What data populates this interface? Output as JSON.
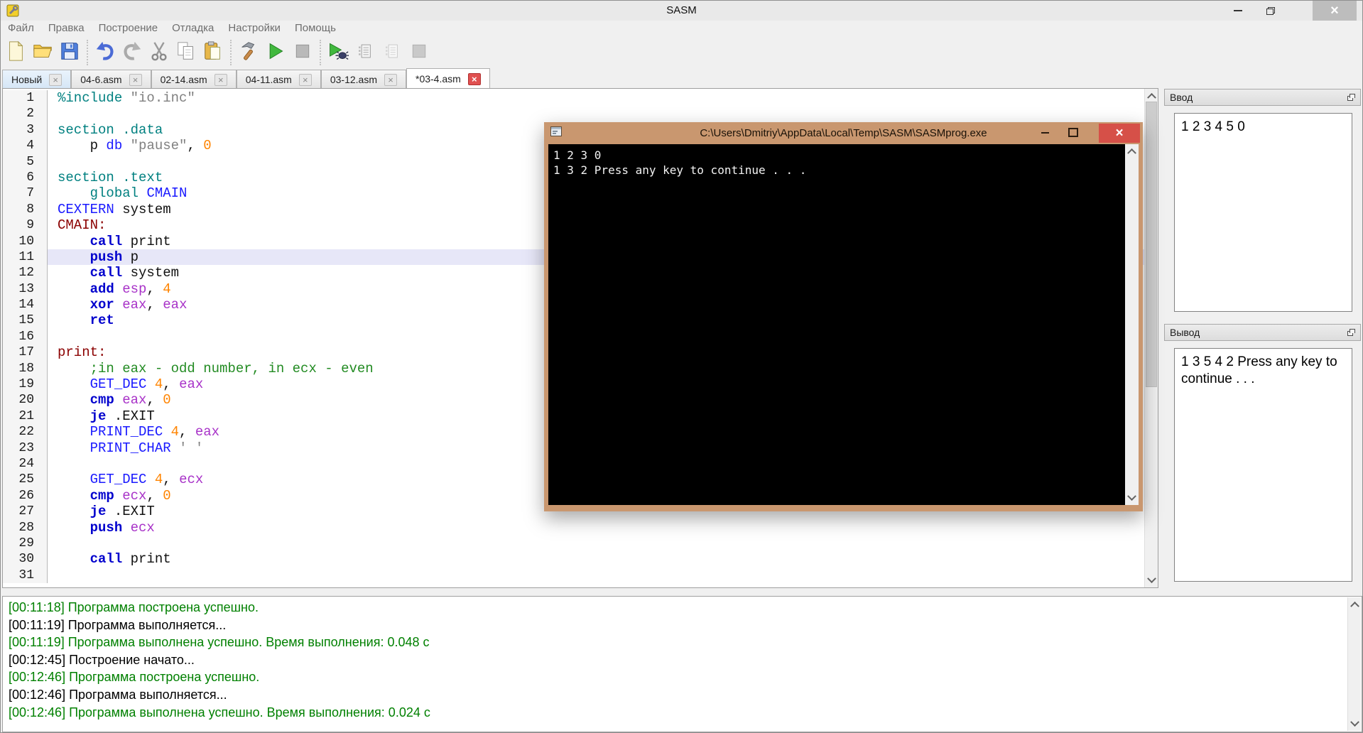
{
  "window": {
    "title": "SASM"
  },
  "menu": [
    "Файл",
    "Правка",
    "Построение",
    "Отладка",
    "Настройки",
    "Помощь"
  ],
  "toolbar": {
    "groups": [
      [
        "new-file",
        "open-folder",
        "save"
      ],
      [
        "undo",
        "redo",
        "cut",
        "copy",
        "paste"
      ],
      [
        "build",
        "run",
        "stop"
      ],
      [
        "debug",
        "debug-registers",
        "debug-memory",
        "stop-debug"
      ]
    ]
  },
  "tabs": [
    {
      "label": "Новый",
      "first": true
    },
    {
      "label": "04-6.asm"
    },
    {
      "label": "02-14.asm"
    },
    {
      "label": "04-11.asm"
    },
    {
      "label": "03-12.asm"
    },
    {
      "label": "*03-4.asm",
      "active": true
    }
  ],
  "editor": {
    "current_line": 11,
    "lines": [
      {
        "n": 1,
        "seg": [
          [
            "sec",
            "%include"
          ],
          [
            "pln",
            " "
          ],
          [
            "str",
            "\"io.inc\""
          ]
        ]
      },
      {
        "n": 2,
        "seg": []
      },
      {
        "n": 3,
        "seg": [
          [
            "sec",
            "section .data"
          ]
        ]
      },
      {
        "n": 4,
        "seg": [
          [
            "pln",
            "    p "
          ],
          [
            "mac",
            "db"
          ],
          [
            "pln",
            " "
          ],
          [
            "str",
            "\"pause\""
          ],
          [
            "pln",
            ", "
          ],
          [
            "num",
            "0"
          ]
        ]
      },
      {
        "n": 5,
        "seg": []
      },
      {
        "n": 6,
        "seg": [
          [
            "sec",
            "section .text"
          ]
        ]
      },
      {
        "n": 7,
        "seg": [
          [
            "sec",
            "    global"
          ],
          [
            "pln",
            " "
          ],
          [
            "mac",
            "CMAIN"
          ]
        ]
      },
      {
        "n": 8,
        "seg": [
          [
            "mac",
            "CEXTERN"
          ],
          [
            "pln",
            " system"
          ]
        ]
      },
      {
        "n": 9,
        "seg": [
          [
            "lbl",
            "CMAIN:"
          ]
        ]
      },
      {
        "n": 10,
        "seg": [
          [
            "pln",
            "    "
          ],
          [
            "kw",
            "call"
          ],
          [
            "pln",
            " print"
          ]
        ]
      },
      {
        "n": 11,
        "seg": [
          [
            "pln",
            "    "
          ],
          [
            "kw",
            "push"
          ],
          [
            "pln",
            " p"
          ]
        ]
      },
      {
        "n": 12,
        "seg": [
          [
            "pln",
            "    "
          ],
          [
            "kw",
            "call"
          ],
          [
            "pln",
            " system"
          ]
        ]
      },
      {
        "n": 13,
        "seg": [
          [
            "pln",
            "    "
          ],
          [
            "kw",
            "add"
          ],
          [
            "pln",
            " "
          ],
          [
            "reg",
            "esp"
          ],
          [
            "pln",
            ", "
          ],
          [
            "num",
            "4"
          ]
        ]
      },
      {
        "n": 14,
        "seg": [
          [
            "pln",
            "    "
          ],
          [
            "kw",
            "xor"
          ],
          [
            "pln",
            " "
          ],
          [
            "reg",
            "eax"
          ],
          [
            "pln",
            ", "
          ],
          [
            "reg",
            "eax"
          ]
        ]
      },
      {
        "n": 15,
        "seg": [
          [
            "pln",
            "    "
          ],
          [
            "kw",
            "ret"
          ]
        ]
      },
      {
        "n": 16,
        "seg": []
      },
      {
        "n": 17,
        "seg": [
          [
            "lbl",
            "print:"
          ]
        ]
      },
      {
        "n": 18,
        "seg": [
          [
            "cmt",
            "    ;in eax - odd number, in ecx - even"
          ]
        ]
      },
      {
        "n": 19,
        "seg": [
          [
            "pln",
            "    "
          ],
          [
            "mac",
            "GET_DEC"
          ],
          [
            "pln",
            " "
          ],
          [
            "num",
            "4"
          ],
          [
            "pln",
            ", "
          ],
          [
            "reg",
            "eax"
          ]
        ]
      },
      {
        "n": 20,
        "seg": [
          [
            "pln",
            "    "
          ],
          [
            "kw",
            "cmp"
          ],
          [
            "pln",
            " "
          ],
          [
            "reg",
            "eax"
          ],
          [
            "pln",
            ", "
          ],
          [
            "num",
            "0"
          ]
        ]
      },
      {
        "n": 21,
        "seg": [
          [
            "pln",
            "    "
          ],
          [
            "kw",
            "je"
          ],
          [
            "pln",
            " .EXIT"
          ]
        ]
      },
      {
        "n": 22,
        "seg": [
          [
            "pln",
            "    "
          ],
          [
            "mac",
            "PRINT_DEC"
          ],
          [
            "pln",
            " "
          ],
          [
            "num",
            "4"
          ],
          [
            "pln",
            ", "
          ],
          [
            "reg",
            "eax"
          ]
        ]
      },
      {
        "n": 23,
        "seg": [
          [
            "pln",
            "    "
          ],
          [
            "mac",
            "PRINT_CHAR"
          ],
          [
            "pln",
            " "
          ],
          [
            "str",
            "' '"
          ]
        ]
      },
      {
        "n": 24,
        "seg": []
      },
      {
        "n": 25,
        "seg": [
          [
            "pln",
            "    "
          ],
          [
            "mac",
            "GET_DEC"
          ],
          [
            "pln",
            " "
          ],
          [
            "num",
            "4"
          ],
          [
            "pln",
            ", "
          ],
          [
            "reg",
            "ecx"
          ]
        ]
      },
      {
        "n": 26,
        "seg": [
          [
            "pln",
            "    "
          ],
          [
            "kw",
            "cmp"
          ],
          [
            "pln",
            " "
          ],
          [
            "reg",
            "ecx"
          ],
          [
            "pln",
            ", "
          ],
          [
            "num",
            "0"
          ]
        ]
      },
      {
        "n": 27,
        "seg": [
          [
            "pln",
            "    "
          ],
          [
            "kw",
            "je"
          ],
          [
            "pln",
            " .EXIT"
          ]
        ]
      },
      {
        "n": 28,
        "seg": [
          [
            "pln",
            "    "
          ],
          [
            "kw",
            "push"
          ],
          [
            "pln",
            " "
          ],
          [
            "reg",
            "ecx"
          ]
        ]
      },
      {
        "n": 29,
        "seg": []
      },
      {
        "n": 30,
        "seg": [
          [
            "pln",
            "    "
          ],
          [
            "kw",
            "call"
          ],
          [
            "pln",
            " print"
          ]
        ]
      },
      {
        "n": 31,
        "seg": []
      }
    ]
  },
  "console": {
    "title": "C:\\Users\\Dmitriy\\AppData\\Local\\Temp\\SASM\\SASMprog.exe",
    "lines": [
      "1 2 3 0",
      "1 3 2 Press any key to continue . . ."
    ]
  },
  "input_panel": {
    "title": "Ввод",
    "value": "1 2 3 4 5 0"
  },
  "output_panel": {
    "title": "Вывод",
    "value": "1 3 5 4 2 Press any key to continue . . ."
  },
  "log": {
    "entries": [
      {
        "time": "[00:11:18]",
        "text": "Программа построена успешно.",
        "status": "success"
      },
      {
        "time": "[00:11:19]",
        "text": "Программа выполняется...",
        "status": "info"
      },
      {
        "time": "[00:11:19]",
        "text": "Программа выполнена успешно. Время выполнения: 0.048 с",
        "status": "success"
      },
      {
        "time": "[00:12:45]",
        "text": "Построение начато...",
        "status": "info"
      },
      {
        "time": "[00:12:46]",
        "text": "Программа построена успешно.",
        "status": "success"
      },
      {
        "time": "[00:12:46]",
        "text": "Программа выполняется...",
        "status": "info"
      },
      {
        "time": "[00:12:46]",
        "text": "Программа выполнена успешно. Время выполнения: 0.024 с",
        "status": "success"
      }
    ]
  },
  "colors": {
    "success": "#008000",
    "keyword_blue": "#0000cd",
    "console_titlebar": "#c9976f",
    "console_close": "#d65048",
    "current_line_bg": "#e7e7f8"
  }
}
